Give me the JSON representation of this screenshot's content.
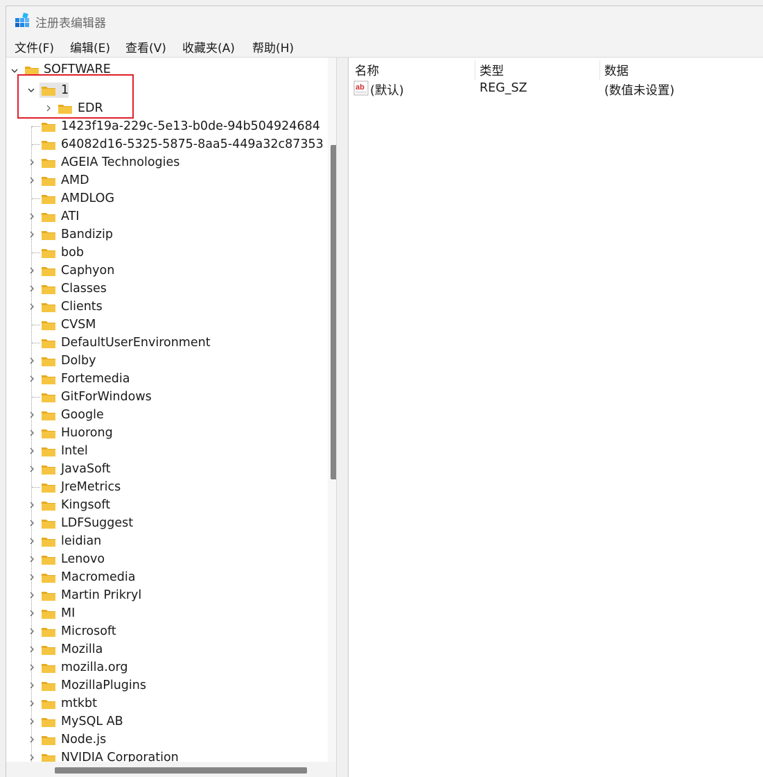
{
  "window": {
    "title": "注册表编辑器"
  },
  "menu": [
    {
      "label": "文件(F)"
    },
    {
      "label": "编辑(E)"
    },
    {
      "label": "查看(V)"
    },
    {
      "label": "收藏夹(A)"
    },
    {
      "label": "帮助(H)"
    }
  ],
  "tree": {
    "root": {
      "label": "SOFTWARE",
      "expanded": true
    },
    "selected": {
      "label": "1",
      "expanded": true,
      "children": [
        {
          "label": "EDR"
        }
      ]
    },
    "items": [
      {
        "label": "1423f19a-229c-5e13-b0de-94b504924684",
        "has_children": false
      },
      {
        "label": "64082d16-5325-5875-8aa5-449a32c87353",
        "has_children": false
      },
      {
        "label": "AGEIA Technologies",
        "has_children": true
      },
      {
        "label": "AMD",
        "has_children": true
      },
      {
        "label": "AMDLOG",
        "has_children": false
      },
      {
        "label": "ATI",
        "has_children": true
      },
      {
        "label": "Bandizip",
        "has_children": true
      },
      {
        "label": "bob",
        "has_children": false
      },
      {
        "label": "Caphyon",
        "has_children": true
      },
      {
        "label": "Classes",
        "has_children": true
      },
      {
        "label": "Clients",
        "has_children": true
      },
      {
        "label": "CVSM",
        "has_children": false
      },
      {
        "label": "DefaultUserEnvironment",
        "has_children": false
      },
      {
        "label": "Dolby",
        "has_children": true
      },
      {
        "label": "Fortemedia",
        "has_children": true
      },
      {
        "label": "GitForWindows",
        "has_children": false
      },
      {
        "label": "Google",
        "has_children": true
      },
      {
        "label": "Huorong",
        "has_children": true
      },
      {
        "label": "Intel",
        "has_children": true
      },
      {
        "label": "JavaSoft",
        "has_children": true
      },
      {
        "label": "JreMetrics",
        "has_children": false
      },
      {
        "label": "Kingsoft",
        "has_children": true
      },
      {
        "label": "LDFSuggest",
        "has_children": true
      },
      {
        "label": "leidian",
        "has_children": true
      },
      {
        "label": "Lenovo",
        "has_children": true
      },
      {
        "label": "Macromedia",
        "has_children": true
      },
      {
        "label": "Martin Prikryl",
        "has_children": true
      },
      {
        "label": "MI",
        "has_children": true
      },
      {
        "label": "Microsoft",
        "has_children": true
      },
      {
        "label": "Mozilla",
        "has_children": true
      },
      {
        "label": "mozilla.org",
        "has_children": true
      },
      {
        "label": "MozillaPlugins",
        "has_children": true
      },
      {
        "label": "mtkbt",
        "has_children": true
      },
      {
        "label": "MySQL AB",
        "has_children": true
      },
      {
        "label": "Node.js",
        "has_children": true
      },
      {
        "label": "NVIDIA Corporation",
        "has_children": true
      }
    ]
  },
  "list": {
    "columns": [
      {
        "label": "名称"
      },
      {
        "label": "类型"
      },
      {
        "label": "数据"
      }
    ],
    "rows": [
      {
        "name": "(默认)",
        "type": "REG_SZ",
        "data": "(数值未设置)"
      }
    ]
  },
  "colors": {
    "folder": "#f5c542",
    "folder_dark": "#e6ab1f",
    "selection": "#e5e5e5",
    "highlight_box": "#e0202a",
    "accent": "#0078d4"
  },
  "icons": {
    "app": "registry-editor-icon",
    "folder": "folder-icon",
    "value": "string-value-icon"
  }
}
